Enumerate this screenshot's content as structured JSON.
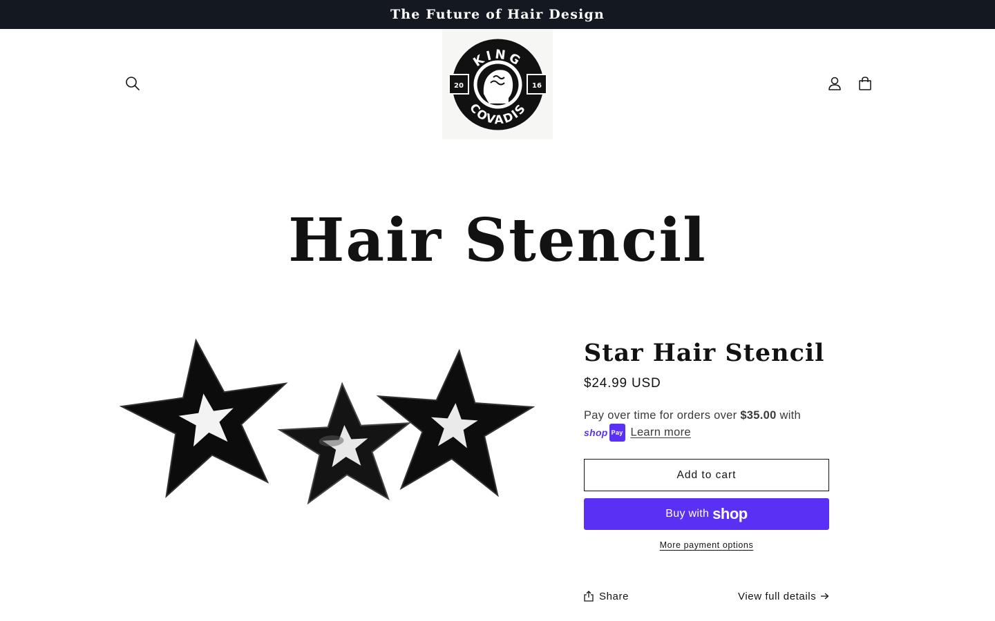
{
  "announcement": {
    "text": "The Future of Hair Design"
  },
  "header": {
    "icons": {
      "search": "search-icon",
      "account": "account-icon",
      "cart": "cart-icon"
    },
    "logo": {
      "top_text": "KING",
      "bottom_text": "COVADIS",
      "left_year": "20",
      "right_year": "16"
    }
  },
  "collection": {
    "title": "Hair Stencil"
  },
  "product": {
    "title": "Star Hair Stencil",
    "price": "$24.99 USD",
    "installments": {
      "prefix": "Pay over time for orders over ",
      "amount": "$35.00",
      "suffix": " with",
      "badge": "shop",
      "badge_pay": "Pay",
      "learn_more": "Learn more"
    },
    "add_to_cart": "Add to cart",
    "buy_with": "Buy with",
    "buy_brand": "shop",
    "more_options": "More payment options",
    "share": "Share",
    "view_details": "View full details"
  },
  "colors": {
    "announcement_bg": "#131821",
    "shop_pay_purple": "#5a31f4",
    "text": "#121212"
  }
}
